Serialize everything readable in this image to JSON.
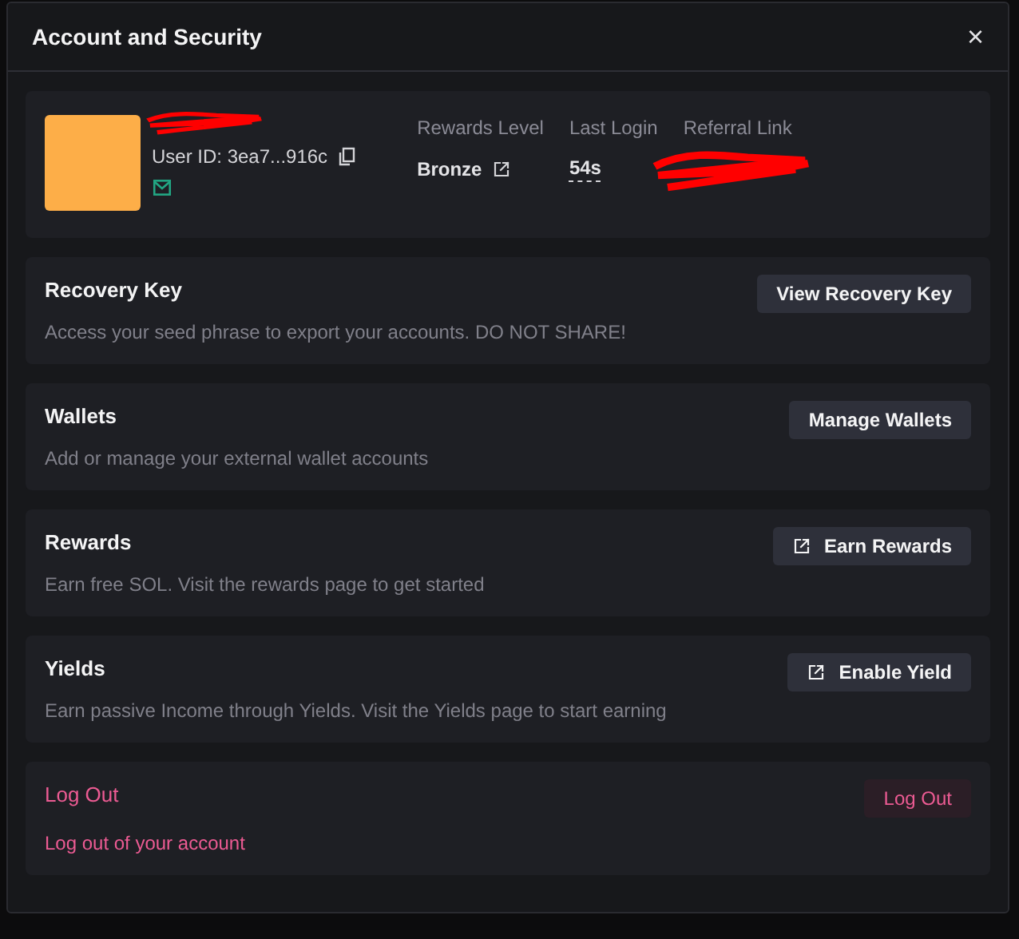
{
  "dialog": {
    "title": "Account and Security",
    "close": "×"
  },
  "profile": {
    "user_id": "User ID: 3ea7...916c",
    "stats": [
      {
        "label": "Rewards Level",
        "value": "Bronze",
        "kind": "link"
      },
      {
        "label": "Last Login",
        "value": "54s",
        "kind": "underlined"
      },
      {
        "label": "Referral Link",
        "kind": "redacted"
      }
    ]
  },
  "sections": [
    {
      "title": "Recovery Key",
      "description": "Access your seed phrase to export your accounts. DO NOT SHARE!",
      "button": "View Recovery Key",
      "external": false,
      "kind": "default"
    },
    {
      "title": "Wallets",
      "description": "Add or manage your external wallet accounts",
      "button": "Manage Wallets",
      "external": false,
      "kind": "default"
    },
    {
      "title": "Rewards",
      "description": "Earn free SOL. Visit the rewards page to get started",
      "button": "Earn Rewards",
      "external": true,
      "kind": "default"
    },
    {
      "title": "Yields",
      "description": "Earn passive Income through Yields. Visit the Yields page to start earning",
      "button": "Enable Yield",
      "external": true,
      "kind": "default"
    },
    {
      "title": "Log Out",
      "description": "Log out of your account",
      "button": "Log Out",
      "external": false,
      "kind": "danger"
    }
  ]
}
